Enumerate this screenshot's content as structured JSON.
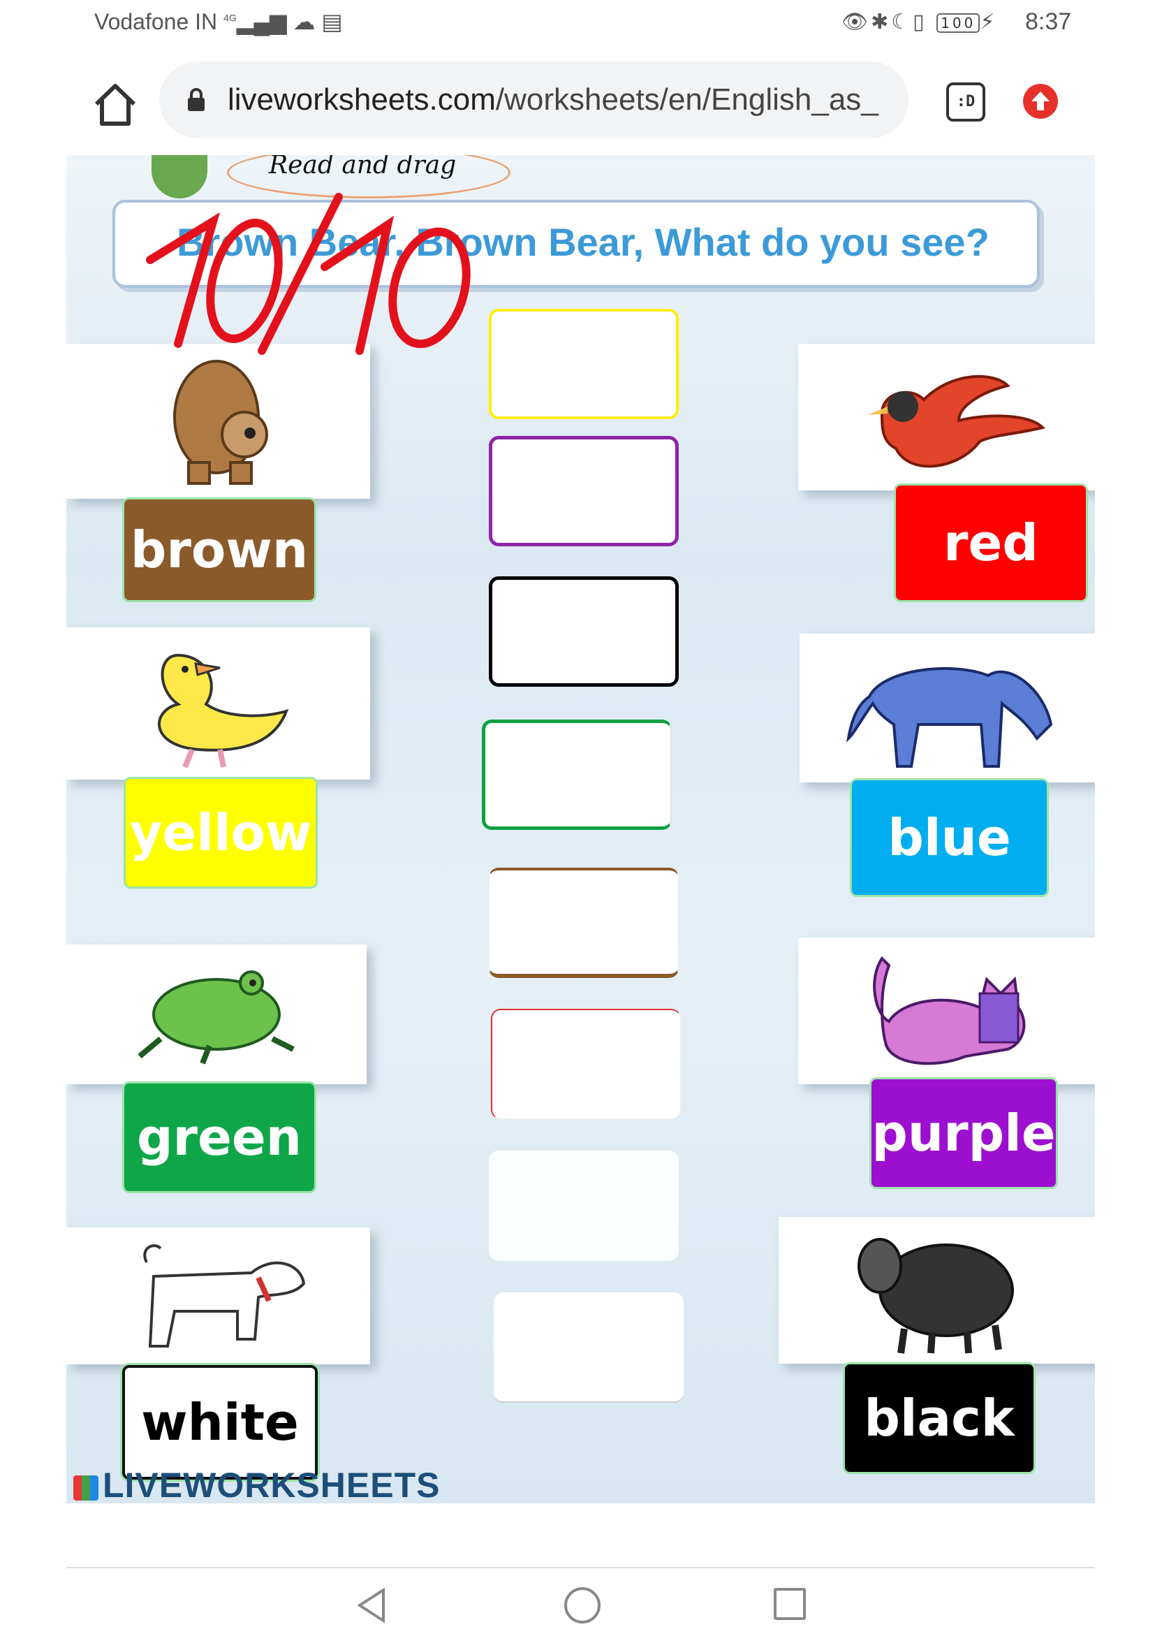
{
  "status_bar": {
    "carrier": "Vodafone IN",
    "network": "4G",
    "battery": "100",
    "time": "8:37"
  },
  "browser": {
    "url_host": "liveworksheets.com",
    "url_path": "/worksheets/en/English_as_",
    "tabs_label": ":D"
  },
  "worksheet": {
    "instruction": "Read and drag",
    "title": "Brown Bear, Brown Bear, What do you see?",
    "score": "10/10",
    "logo": "LIVEWORKSHEETS",
    "left_cards": [
      {
        "animal": "bear-icon",
        "word": "brown",
        "bg": "#8b5a2b",
        "fg": "#ffffff"
      },
      {
        "animal": "duck-icon",
        "word": "yellow",
        "bg": "#ffff00",
        "fg": "#ffffff"
      },
      {
        "animal": "frog-icon",
        "word": "green",
        "bg": "#0fa64a",
        "fg": "#ffffff"
      },
      {
        "animal": "dog-icon",
        "word": "white",
        "bg": "#ffffff",
        "fg": "#000000"
      }
    ],
    "right_cards": [
      {
        "animal": "bird-icon",
        "word": "red",
        "bg": "#ff0000",
        "fg": "#ffffff"
      },
      {
        "animal": "horse-icon",
        "word": "blue",
        "bg": "#00aeef",
        "fg": "#ffffff"
      },
      {
        "animal": "cat-icon",
        "word": "purple",
        "bg": "#9d0fd0",
        "fg": "#ffffff"
      },
      {
        "animal": "sheep-icon",
        "word": "black",
        "bg": "#000000",
        "fg": "#ffffff"
      }
    ],
    "drop_box_colors": [
      "#ffee00",
      "#8e24aa",
      "#000000",
      "#10a040",
      "#8b5a2b",
      "#e03030",
      "#f4f4f4",
      "#dddddd"
    ]
  },
  "nav": {
    "back": "back-icon",
    "home": "home-circle-icon",
    "recents": "recents-icon"
  }
}
